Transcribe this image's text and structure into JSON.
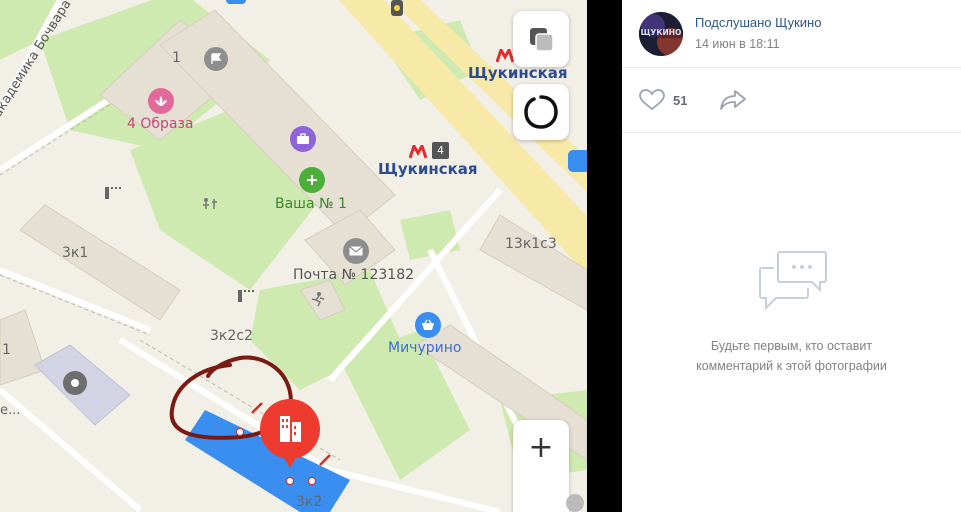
{
  "map": {
    "labels": {
      "street": "академика Бочвара",
      "bldg_1": "1",
      "bldg_1_left": "1",
      "obraza": "4 Образа",
      "metro_top": "Щукинская",
      "metro_main": "Щукинская",
      "metro_line": "4",
      "vasha": "Ваша № 1",
      "bldg_3k1": "3к1",
      "pochta": "Почта № 123182",
      "bldg_13k1s3": "13к1с3",
      "bldg_3k2s2": "3к2с2",
      "michurino": "Мичурино",
      "bldg_3k2": "3к2",
      "dots": "е..."
    },
    "zoom_in_label": "+"
  },
  "post": {
    "author": "Подслушано Щукино",
    "date": "14 июн в 18:11",
    "avatar_text": "ЩУКИНО",
    "likes": "51"
  },
  "comments": {
    "empty_line1": "Будьте первым, кто оставит",
    "empty_line2": "комментарий к этой фотографии"
  },
  "colors": {
    "link": "#2a5885",
    "muted": "#828282",
    "map_bg": "#f2efe7",
    "green": "#cfeab0",
    "building": "#e6dfd3",
    "road_yellow": "#f7e9a8",
    "metro_red": "#e32d2d",
    "marker_red": "#ee3b2f",
    "highlight_blue": "#3a8ef0",
    "drawing": "#7a1a12"
  }
}
